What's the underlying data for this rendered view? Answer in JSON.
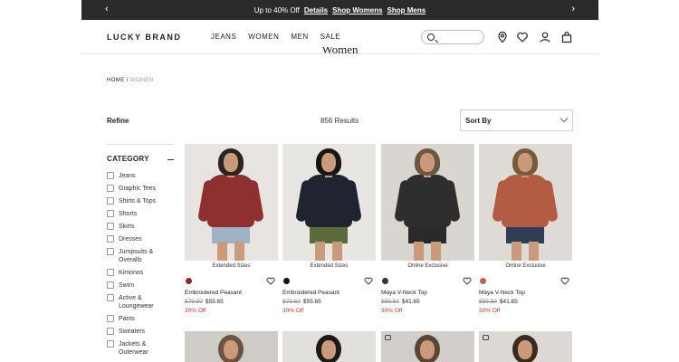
{
  "promo": {
    "text": "Up to 40% Off",
    "links": [
      "Details",
      "Shop Womens",
      "Shop Mens"
    ]
  },
  "header": {
    "logo": "LUCKY BRAND",
    "nav": [
      "JEANS",
      "WOMEN",
      "MEN",
      "SALE"
    ],
    "search_placeholder": ""
  },
  "page_title": "Women",
  "breadcrumb": {
    "home": "HOME",
    "sep": "/",
    "current": "WOMEN"
  },
  "toolbar": {
    "refine": "Refine",
    "results": "856 Results",
    "sort": "Sort By"
  },
  "sidebar": {
    "category_title": "CATEGORY",
    "categories": [
      "Jeans",
      "Graphic Tees",
      "Shirts & Tops",
      "Shorts",
      "Skirts",
      "Dresses",
      "Jumpsuits & Overalls",
      "Kimonos",
      "Swim",
      "Active & Loungewear",
      "Pants",
      "Sweaters",
      "Jackets & Outerwear"
    ]
  },
  "products": [
    {
      "badge": "Extended Sizes",
      "name": "Embroidered Peasant",
      "orig": "$79.50",
      "price": "$55.65",
      "off": "30% Off",
      "swatch": "#8b2e2e",
      "top": "#8e2f30",
      "bg": "#e7e4e1",
      "hairc": "#2d2420",
      "bottom": "#9fb1c4"
    },
    {
      "badge": "Extended Sizes",
      "name": "Embroidered Peasant",
      "orig": "$79.50",
      "price": "$55.65",
      "off": "30% Off",
      "swatch": "#111111",
      "top": "#1f2430",
      "bg": "#e8e6e3",
      "hairc": "#1c1612",
      "bottom": "#5c6a3e"
    },
    {
      "badge": "Online Exclusive",
      "name": "Maya V-Neck Top",
      "orig": "$59.50",
      "price": "$41.65",
      "off": "30% Off",
      "swatch": "#333333",
      "top": "#2e2e2e",
      "bg": "#d9d6d2",
      "hairc": "#6e5640",
      "bottom": "#2a2a2a"
    },
    {
      "badge": "Online Exclusive",
      "name": "Maya V-Neck Top",
      "orig": "$59.50",
      "price": "$41.65",
      "off": "30% Off",
      "swatch": "#b5654f",
      "top": "#b45c43",
      "bg": "#dedbd7",
      "hairc": "#7a5a3c",
      "bottom": "#2f3d55"
    }
  ],
  "peek": [
    {
      "bg": "#cfccc8",
      "hairc": "#6b5340",
      "icon": false
    },
    {
      "bg": "#e2e0dd",
      "hairc": "#1d1915",
      "icon": false
    },
    {
      "bg": "#d0cdca",
      "hairc": "#5a4535",
      "icon": true
    },
    {
      "bg": "#dcd9d5",
      "hairc": "#3a2a1f",
      "icon": true
    }
  ]
}
